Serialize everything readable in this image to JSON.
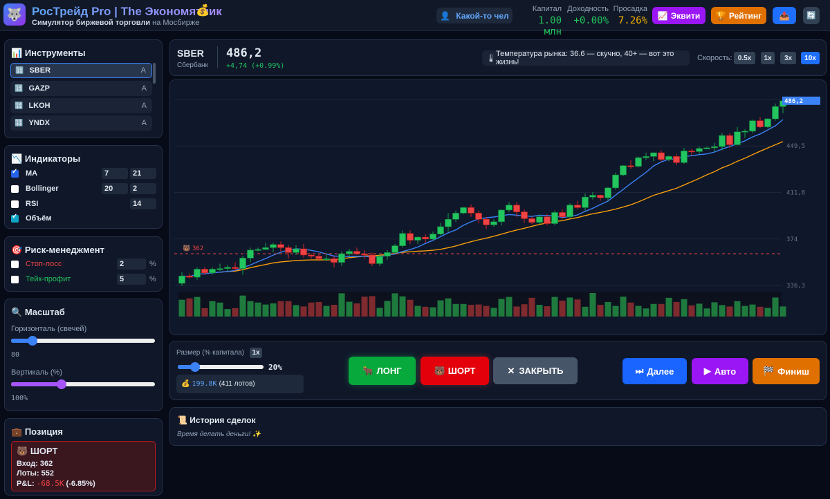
{
  "header": {
    "logo_icon": "wolf-icon",
    "title": "РосТрейд Pro | The Экономятник",
    "title_icon": "money-bag-icon",
    "subtitle_bold": "Симулятор биржевой торговли",
    "subtitle_rest": "на Мосбирже",
    "user": "Какой-то чел",
    "stats": [
      {
        "label": "Капитал",
        "value": "1.00 млн",
        "color": "#22c55e"
      },
      {
        "label": "Доходность",
        "value": "+0.00%",
        "color": "#22c55e"
      },
      {
        "label": "Просадка",
        "value": "7.26%",
        "color": "#f5b400"
      }
    ],
    "equity_label": "Эквити",
    "rating_label": "Рейтинг"
  },
  "instruments": {
    "title": "Инструменты",
    "items": [
      {
        "ticker": "SBER",
        "tag": "A"
      },
      {
        "ticker": "GAZP",
        "tag": "A"
      },
      {
        "ticker": "LKOH",
        "tag": "A"
      },
      {
        "ticker": "YNDX",
        "tag": "A"
      }
    ]
  },
  "indicators": {
    "title": "Индикаторы",
    "ma": {
      "label": "MA",
      "checked": true,
      "p1": "7",
      "p2": "21"
    },
    "bollinger": {
      "label": "Bollinger",
      "checked": false,
      "p1": "20",
      "p2": "2"
    },
    "rsi": {
      "label": "RSI",
      "checked": false,
      "p1": "14"
    },
    "volume": {
      "label": "Объём",
      "checked": true
    }
  },
  "risk": {
    "title": "Риск-менеджмент",
    "stop_label": "Стоп-лосс",
    "stop_value": "2",
    "take_label": "Тейк-профит",
    "take_value": "5",
    "unit": "%"
  },
  "scale": {
    "title": "Масштаб",
    "h_label": "Горизонталь (свечей)",
    "h_value": "80",
    "h_fraction": 0.15,
    "v_label": "Вертикаль (%)",
    "v_value": "100%",
    "v_fraction": 0.35
  },
  "position": {
    "title": "Позиция",
    "side": "ШОРТ",
    "entry": "Вход: 362",
    "lots": "Лоты: 552",
    "pnl_label": "P&L:",
    "pnl_value": "-68.5K",
    "pnl_pct": "(-6.85%)"
  },
  "ticker": {
    "symbol": "SBER",
    "name": "Сбербанк",
    "price": "486,2",
    "change": "+4,74 (+0.99%)",
    "temperature": "Температура рынка: 36.6 — скучно, 40+ — вот это жизнь!",
    "speed_label": "Скорость:",
    "speeds": [
      "0.5x",
      "1x",
      "3x",
      "10x"
    ],
    "speed_active": "10x"
  },
  "trade": {
    "size_label": "Размер (% капитала)",
    "mult": "1x",
    "size_value": "20%",
    "size_fraction": 0.2,
    "amount": "199.8K",
    "lots": "(411 лотов)",
    "long": "ЛОНГ",
    "short": "ШОРТ",
    "close": "ЗАКРЫТЬ",
    "next": "Далее",
    "auto": "Авто",
    "finish": "Финиш"
  },
  "history": {
    "title": "История сделок",
    "empty": "Время делать деньги!"
  },
  "chart_data": {
    "type": "candlestick",
    "y_ticks": [
      "449,5",
      "411,8",
      "374",
      "336,3"
    ],
    "y_tick_values": [
      449.5,
      411.8,
      374,
      336.3
    ],
    "ylim": [
      336.3,
      487.2
    ],
    "last_price": 486.2,
    "last_label": "486,2",
    "entry_price": 362,
    "entry_label": "362",
    "ma_periods": [
      7,
      21
    ],
    "ohlc": [
      [
        338,
        347,
        336,
        344
      ],
      [
        344,
        346,
        342,
        343
      ],
      [
        343,
        351,
        341,
        349.5
      ],
      [
        349.5,
        351,
        345,
        346.5
      ],
      [
        346.5,
        351,
        345,
        349.5
      ],
      [
        349.5,
        354,
        348,
        350
      ],
      [
        350,
        353,
        348,
        351
      ],
      [
        351,
        355,
        348,
        350
      ],
      [
        350,
        360,
        345,
        358.5
      ],
      [
        358.5,
        367,
        355,
        365
      ],
      [
        365,
        367,
        364,
        365.5
      ],
      [
        365.5,
        371,
        365,
        367
      ],
      [
        367,
        371,
        363,
        369.5
      ],
      [
        369.5,
        372,
        364,
        367
      ],
      [
        367,
        369,
        358,
        363
      ],
      [
        363,
        369,
        361,
        366
      ],
      [
        366,
        370,
        359,
        361
      ],
      [
        361,
        362,
        358,
        360
      ],
      [
        360,
        362,
        356,
        358
      ],
      [
        358,
        362,
        356,
        358
      ],
      [
        358,
        360,
        351,
        355
      ],
      [
        355,
        364,
        352,
        362
      ],
      [
        362,
        366,
        360,
        364
      ],
      [
        364,
        367,
        361,
        362
      ],
      [
        362,
        365,
        358,
        361
      ],
      [
        361,
        363,
        352,
        354
      ],
      [
        354,
        362,
        352,
        360
      ],
      [
        360,
        365,
        357,
        363
      ],
      [
        363,
        370,
        362,
        368.5
      ],
      [
        368.5,
        381,
        367,
        378.5
      ],
      [
        378.5,
        381,
        370,
        373
      ],
      [
        373,
        376,
        370,
        375.5
      ],
      [
        375.5,
        378,
        371,
        374
      ],
      [
        374,
        380,
        373,
        378
      ],
      [
        378,
        387,
        377,
        384
      ],
      [
        384,
        395,
        380,
        390
      ],
      [
        390,
        397,
        388,
        395
      ],
      [
        395,
        400,
        394,
        399.5
      ],
      [
        399.5,
        402,
        392,
        395
      ],
      [
        395,
        397,
        387,
        390
      ],
      [
        390,
        392,
        382,
        385.5
      ],
      [
        385.5,
        390,
        384,
        388
      ],
      [
        388,
        398,
        385,
        397.5
      ],
      [
        397.5,
        404,
        396,
        401.5
      ],
      [
        401.5,
        404,
        392,
        396
      ],
      [
        396,
        398,
        387,
        390.5
      ],
      [
        390.5,
        392,
        386,
        387.5
      ],
      [
        387.5,
        394,
        386,
        392
      ],
      [
        392,
        394,
        385,
        386.5
      ],
      [
        386.5,
        397,
        385,
        395.5
      ],
      [
        395.5,
        398,
        390,
        392
      ],
      [
        392,
        403,
        391,
        401.5
      ],
      [
        401.5,
        405,
        398,
        399.5
      ],
      [
        399.5,
        411,
        397,
        408
      ],
      [
        408,
        412,
        406,
        409.5
      ],
      [
        409.5,
        410,
        405,
        407.5
      ],
      [
        407.5,
        416,
        405,
        415.5
      ],
      [
        415.5,
        428,
        414,
        426
      ],
      [
        426,
        434,
        425,
        433.5
      ],
      [
        433.5,
        438,
        431,
        433
      ],
      [
        433,
        441,
        432,
        440
      ],
      [
        440,
        444,
        438,
        441
      ],
      [
        441,
        444,
        437,
        444
      ],
      [
        444,
        446,
        437,
        438.5
      ],
      [
        438.5,
        442,
        437,
        441
      ],
      [
        441,
        443,
        434,
        436
      ],
      [
        436,
        448,
        435,
        445.5
      ],
      [
        445.5,
        447,
        442,
        445
      ],
      [
        445,
        449,
        443,
        447.5
      ],
      [
        447.5,
        449,
        447,
        448
      ],
      [
        448,
        452,
        445,
        449
      ],
      [
        449,
        460,
        446,
        458
      ],
      [
        458,
        460,
        448,
        450.5
      ],
      [
        450.5,
        465,
        450,
        461
      ],
      [
        461,
        463,
        456,
        461.5
      ],
      [
        461.5,
        471,
        460,
        470
      ],
      [
        470,
        473,
        464,
        465
      ],
      [
        465,
        472,
        464,
        471.5
      ],
      [
        471.5,
        484,
        470,
        481.5
      ],
      [
        481.5,
        488,
        476,
        486.2
      ]
    ],
    "volume": [
      6,
      6.5,
      7,
      3,
      5.5,
      5,
      2.7,
      3,
      7.5,
      5.5,
      5,
      4.3,
      4.7,
      5.5,
      5.5,
      4.1,
      3.6,
      5,
      5.2,
      3.8,
      4.2,
      8.3,
      5.3,
      4.7,
      7.1,
      7.3,
      3.1,
      5.6,
      8.3,
      7.2,
      6,
      3.8,
      3.5,
      3.3,
      5.8,
      6.5,
      4.5,
      4.5,
      4.2,
      4.3,
      3.8,
      3.1,
      6.3,
      7,
      3.6,
      4.4,
      6.7,
      4.2,
      3.7,
      7,
      5.7,
      6.8,
      6.1,
      3.5,
      8.4,
      4.2,
      5.2,
      3.8,
      7.1,
      5,
      3.8,
      2.9,
      4.5,
      4.5,
      6.7,
      5.2,
      6.2,
      4,
      4.6,
      2.9,
      5.1,
      4.1,
      3.6,
      5.5,
      3.8,
      4.3,
      3.5,
      3.1,
      6.8,
      3.6
    ]
  },
  "colors": {
    "up": "#22c55e",
    "down": "#ef4444",
    "ma_fast": "#3b82f6",
    "ma_slow": "#f59e0b",
    "accent": "#3b82f6"
  }
}
